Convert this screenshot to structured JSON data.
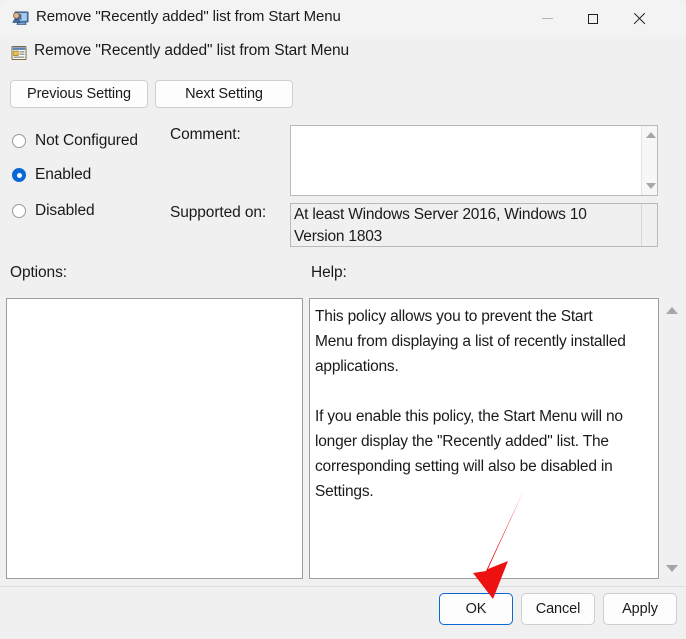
{
  "window": {
    "title": "Remove \"Recently added\" list from Start Menu",
    "icon": "policy-window-icon",
    "controls": {
      "minimize": "minimize-icon",
      "maximize": "maximize-icon",
      "close": "close-icon"
    }
  },
  "header": {
    "policy_title": "Remove \"Recently added\" list from Start Menu",
    "icon": "policy-setting-icon"
  },
  "navigation": {
    "previous_label": "Previous Setting",
    "next_label": "Next Setting"
  },
  "state": {
    "options": [
      {
        "id": "not-configured",
        "label": "Not Configured",
        "selected": false
      },
      {
        "id": "enabled",
        "label": "Enabled",
        "selected": true
      },
      {
        "id": "disabled",
        "label": "Disabled",
        "selected": false
      }
    ],
    "selected_value": "Enabled"
  },
  "comment": {
    "label": "Comment:",
    "value": "",
    "placeholder": ""
  },
  "supported": {
    "label": "Supported on:",
    "value": "At least Windows Server 2016, Windows 10 Version 1803"
  },
  "options_panel": {
    "label": "Options:",
    "content": ""
  },
  "help_panel": {
    "label": "Help:",
    "text": "This policy allows you to prevent the Start Menu from displaying a list of recently installed applications.\n\nIf you enable this policy, the Start Menu will no longer display the \"Recently added\" list. The corresponding setting will also be disabled in Settings."
  },
  "footer": {
    "ok_label": "OK",
    "cancel_label": "Cancel",
    "apply_label": "Apply",
    "default_button": "OK"
  },
  "annotation": {
    "type": "arrow",
    "color": "#ee1111",
    "points_to": "OK"
  },
  "colors": {
    "accent": "#0a68d4",
    "window_bg": "#f0f0f0",
    "titlebar_bg": "#f3f3f3",
    "field_bg": "#ffffff",
    "text": "#1a1a1a",
    "annotation_red": "#ee1111"
  }
}
